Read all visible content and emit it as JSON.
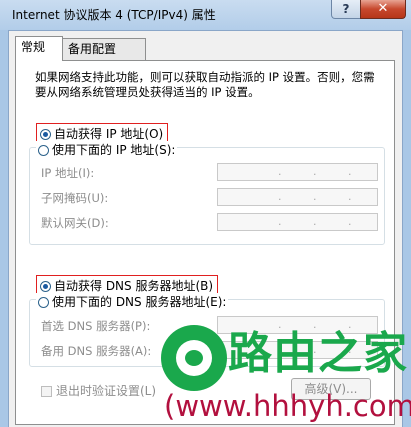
{
  "window": {
    "title": "Internet 协议版本 4 (TCP/IPv4) 属性",
    "help": "?",
    "close": "✕"
  },
  "tabs": [
    {
      "label": "常规",
      "active": true
    },
    {
      "label": "备用配置",
      "active": false
    }
  ],
  "description": "如果网络支持此功能，则可以获取自动指派的 IP 设置。否则，您需要从网络系统管理员处获得适当的 IP 设置。",
  "ip_section": {
    "auto_label": "自动获得 IP 地址(O)",
    "auto_selected": true,
    "manual_label": "使用下面的 IP 地址(S):",
    "fields": [
      {
        "label": "IP 地址(I):"
      },
      {
        "label": "子网掩码(U):"
      },
      {
        "label": "默认网关(D):"
      }
    ]
  },
  "dns_section": {
    "auto_label": "自动获得 DNS 服务器地址(B)",
    "auto_selected": true,
    "manual_label": "使用下面的 DNS 服务器地址(E):",
    "fields": [
      {
        "label": "首选 DNS 服务器(P):"
      },
      {
        "label": "备用 DNS 服务器(A):"
      }
    ]
  },
  "validate_checkbox": {
    "label": "退出时验证设置(L)",
    "checked": false
  },
  "advanced_button": "高级(V)...",
  "watermark": {
    "brand": "路由之家",
    "url": "(www.hhhyh.com)"
  },
  "colors": {
    "highlight_border": "#e02020",
    "watermark_green": "#1aa84c",
    "watermark_red": "#b2103e"
  }
}
